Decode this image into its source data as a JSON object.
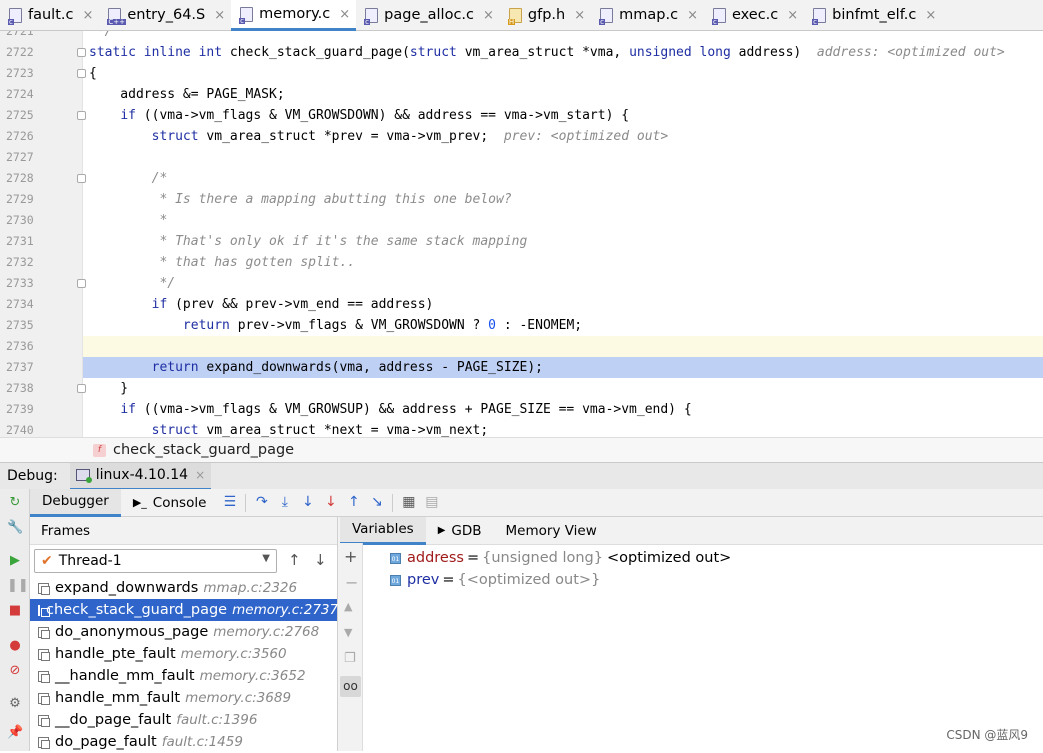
{
  "tabs": [
    {
      "name": "fault.c",
      "kind": "c"
    },
    {
      "name": "entry_64.S",
      "kind": "C++"
    },
    {
      "name": "memory.c",
      "kind": "c",
      "active": true
    },
    {
      "name": "page_alloc.c",
      "kind": "c"
    },
    {
      "name": "gfp.h",
      "kind": "H"
    },
    {
      "name": "mmap.c",
      "kind": "c"
    },
    {
      "name": "exec.c",
      "kind": "c"
    },
    {
      "name": "binfmt_elf.c",
      "kind": "c"
    }
  ],
  "editor": {
    "lines": [
      {
        "num": "2721",
        "html": "<span class='cm'> */</span>"
      },
      {
        "num": "2722",
        "html": "<span class='kw'>static inline int</span> check_stack_guard_page(<span class='kw'>struct</span> vm_area_struct *vma, <span class='kw'>unsigned long</span> address)  <span class='hint'>address: &lt;optimized out&gt;</span>"
      },
      {
        "num": "2723",
        "html": "{"
      },
      {
        "num": "2724",
        "html": "    address &amp;= PAGE_MASK;"
      },
      {
        "num": "2725",
        "html": "    <span class='kw'>if</span> ((vma-&gt;vm_flags &amp; VM_GROWSDOWN) &amp;&amp; address == vma-&gt;vm_start) {"
      },
      {
        "num": "2726",
        "html": "        <span class='kw'>struct</span> vm_area_struct *prev = vma-&gt;vm_prev;  <span class='hint'>prev: &lt;optimized out&gt;</span>"
      },
      {
        "num": "2727",
        "html": ""
      },
      {
        "num": "2728",
        "html": "        <span class='cm'>/*</span>"
      },
      {
        "num": "2729",
        "html": "<span class='cm'>         * Is there a mapping abutting this one below?</span>"
      },
      {
        "num": "2730",
        "html": "<span class='cm'>         *</span>"
      },
      {
        "num": "2731",
        "html": "<span class='cm'>         * That's only ok if it's the same stack mapping</span>"
      },
      {
        "num": "2732",
        "html": "<span class='cm'>         * that has gotten split..</span>"
      },
      {
        "num": "2733",
        "html": "<span class='cm'>         */</span>"
      },
      {
        "num": "2734",
        "html": "        <span class='kw'>if</span> (prev &amp;&amp; prev-&gt;vm_end == address)"
      },
      {
        "num": "2735",
        "html": "            <span class='kw'>return</span> prev-&gt;vm_flags &amp; VM_GROWSDOWN ? <span class='num'>0</span> : -ENOMEM;"
      },
      {
        "num": "2736",
        "html": "",
        "caret": true
      },
      {
        "num": "2737",
        "html": "        <span class='kw'>return</span> expand_downwards(vma, address - PAGE_SIZE);",
        "exec": true
      },
      {
        "num": "2738",
        "html": "    }"
      },
      {
        "num": "2739",
        "html": "    <span class='kw'>if</span> ((vma-&gt;vm_flags &amp; VM_GROWSUP) &amp;&amp; address + PAGE_SIZE == vma-&gt;vm_end) {"
      },
      {
        "num": "2740",
        "html": "        <span class='kw'>struct</span> vm_area_struct *next = vma-&gt;vm_next;"
      }
    ]
  },
  "breadcrumb": {
    "badge": "f",
    "label": "check_stack_guard_page"
  },
  "debug": {
    "label": "Debug:",
    "session": "linux-4.10.14",
    "subtabs": {
      "debugger": "Debugger",
      "console": "Console"
    },
    "frames_title": "Frames",
    "thread": "Thread-1",
    "frames": [
      {
        "fn": "expand_downwards",
        "loc": "mmap.c:2326"
      },
      {
        "fn": "check_stack_guard_page",
        "loc": "memory.c:2737",
        "selected": true
      },
      {
        "fn": "do_anonymous_page",
        "loc": "memory.c:2768"
      },
      {
        "fn": "handle_pte_fault",
        "loc": "memory.c:3560"
      },
      {
        "fn": "__handle_mm_fault",
        "loc": "memory.c:3652"
      },
      {
        "fn": "handle_mm_fault",
        "loc": "memory.c:3689"
      },
      {
        "fn": "__do_page_fault",
        "loc": "fault.c:1396"
      },
      {
        "fn": "do_page_fault",
        "loc": "fault.c:1459"
      }
    ],
    "var_tabs": {
      "variables": "Variables",
      "gdb": "GDB",
      "memory": "Memory View"
    },
    "variables": [
      {
        "name": "address",
        "type": "{unsigned long}",
        "value": "<optimized out>"
      },
      {
        "name": "prev",
        "type": "",
        "value": "{<optimized out>}"
      }
    ]
  },
  "watermark": "CSDN @蓝风9"
}
